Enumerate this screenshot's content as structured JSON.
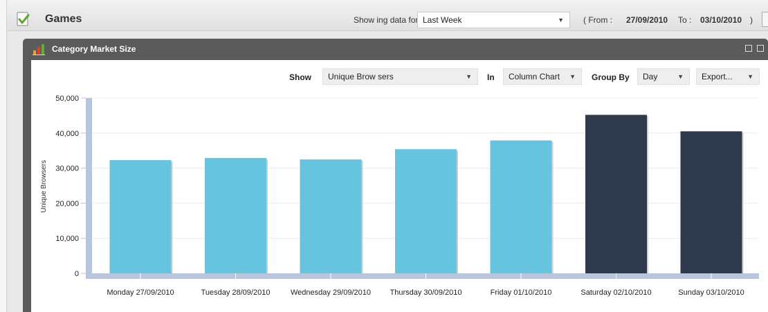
{
  "header": {
    "title": "Games",
    "showing_label": "Show ing data for",
    "period_value": "Last Week",
    "from_label": "(    From :",
    "from_date": "27/09/2010",
    "to_label": "To :",
    "to_date": "03/10/2010",
    "close_paren": ")"
  },
  "panel": {
    "title": "Category Market Size"
  },
  "controls": {
    "show_label": "Show",
    "show_value": "Unique Brow sers",
    "in_label": "In",
    "in_value": "Column Chart",
    "group_label": "Group By",
    "group_value": "Day",
    "export_value": "Export..."
  },
  "colors": {
    "weekday_bar": "#66c4df",
    "weekend_bar": "#2f3a4c",
    "axis": "#b8c6dd"
  },
  "chart_data": {
    "type": "bar",
    "title": "",
    "xlabel": "",
    "ylabel": "Unique Browsers",
    "ylim": [
      0,
      50000
    ],
    "yticks": [
      0,
      10000,
      20000,
      30000,
      40000,
      50000
    ],
    "ytick_labels": [
      "0",
      "10,000",
      "20,000",
      "30,000",
      "40,000",
      "50,000"
    ],
    "categories": [
      "Monday 27/09/2010",
      "Tuesday 28/09/2010",
      "Wednesday 29/09/2010",
      "Thursday 30/09/2010",
      "Friday 01/10/2010",
      "Saturday 02/10/2010",
      "Sunday 03/10/2010"
    ],
    "values": [
      32300,
      32900,
      32500,
      35400,
      37900,
      45200,
      40500
    ],
    "highlight": [
      false,
      false,
      false,
      false,
      false,
      true,
      true
    ],
    "grid": true
  }
}
